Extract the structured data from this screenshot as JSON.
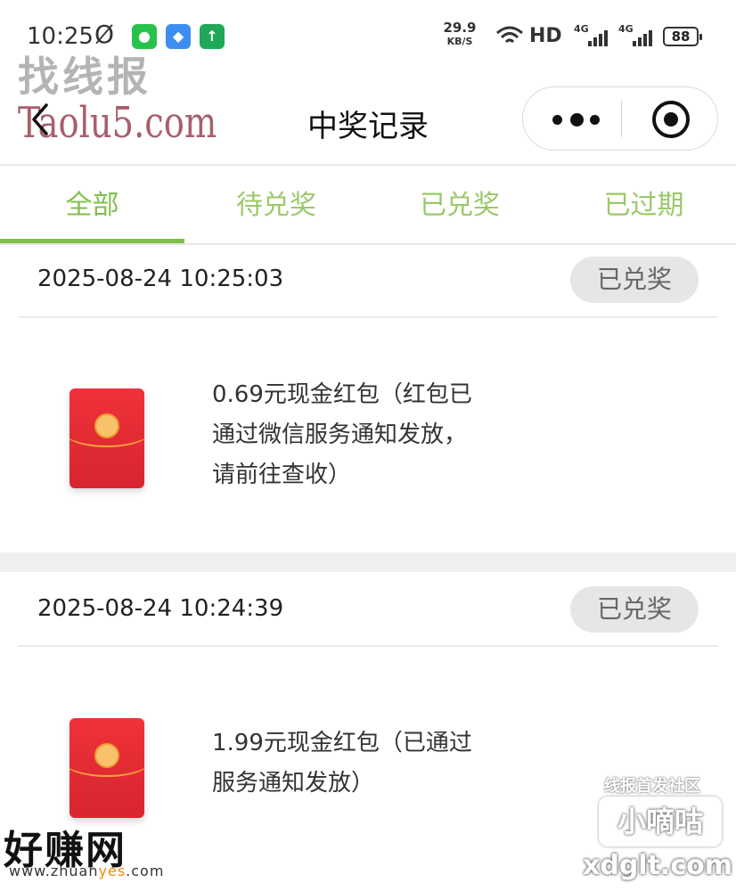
{
  "status_bar": {
    "time": "10:25",
    "dnd_symbol": "Ø",
    "net_speed_value": "29.9",
    "net_speed_unit": "KB/S",
    "hd_label": "HD",
    "network_1": "4G",
    "network_2": "4G",
    "battery": "88",
    "app_icons": [
      "wechat-icon",
      "blue-app-icon",
      "upload-app-icon"
    ]
  },
  "watermarks": {
    "top_chinese": "找线报",
    "top_latin": "Taolu5.com",
    "bottom_left_chinese": "好赚网",
    "bottom_left_url_prefix": "www.zhuan",
    "bottom_left_url_highlight": "yes",
    "bottom_left_url_suffix": ".com",
    "bottom_right_tagline": "线报首发社区",
    "bottom_right_brand": "小嘀咕",
    "bottom_right_url": "xdglt.com"
  },
  "nav": {
    "title": "中奖记录",
    "back_icon": "chevron-left-icon",
    "more_icon": "more-dots-icon",
    "close_icon": "target-close-icon"
  },
  "tabs": [
    {
      "label": "全部",
      "active": true
    },
    {
      "label": "待兑奖",
      "active": false
    },
    {
      "label": "已兑奖",
      "active": false
    },
    {
      "label": "已过期",
      "active": false
    }
  ],
  "records": [
    {
      "datetime": "2025-08-24 10:25:03",
      "status": "已兑奖",
      "description_lines": [
        "0.69元现金红包（红包已",
        "通过微信服务通知发放，",
        "请前往查收）"
      ],
      "icon": "red-envelope-icon"
    },
    {
      "datetime": "2025-08-24 10:24:39",
      "status": "已兑奖",
      "description_lines": [
        "1.99元现金红包（已通过",
        "服务通知发放）"
      ],
      "icon": "red-envelope-icon"
    }
  ],
  "colors": {
    "accent_green": "#7fbf4b",
    "badge_bg": "#e6e6e6",
    "envelope_red": "#e02a33"
  }
}
